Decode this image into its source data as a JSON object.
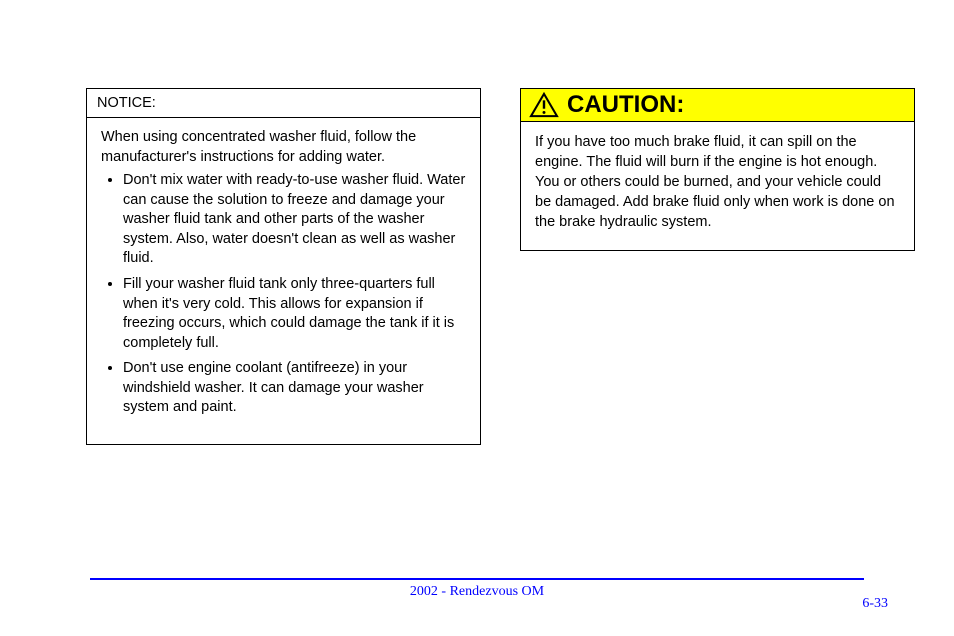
{
  "leftBox": {
    "header": "NOTICE:",
    "intro": "When using concentrated washer fluid, follow the manufacturer's instructions for adding water.",
    "items": [
      "Don't mix water with ready-to-use washer fluid. Water can cause the solution to freeze and damage your washer fluid tank and other parts of the washer system. Also, water doesn't clean as well as washer fluid.",
      "Fill your washer fluid tank only three-quarters full when it's very cold. This allows for expansion if freezing occurs, which could damage the tank if it is completely full.",
      "Don't use engine coolant (antifreeze) in your windshield washer. It can damage your washer system and paint."
    ]
  },
  "caution": {
    "title": "CAUTION:",
    "body": "If you have too much brake fluid, it can spill on the engine. The fluid will burn if the engine is hot enough. You or others could be burned, and your vehicle could be damaged. Add brake fluid only when work is done on the brake hydraulic system."
  },
  "footer": {
    "line": "2002 - Rendezvous OM",
    "pageNum": "6-33"
  }
}
